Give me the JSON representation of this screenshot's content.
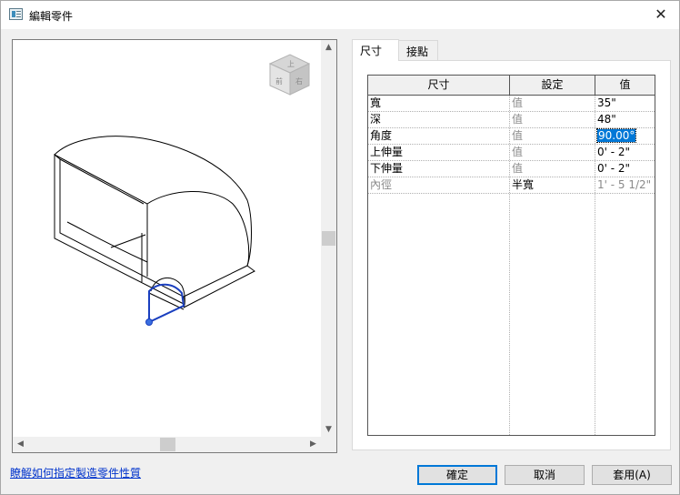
{
  "window": {
    "title": "編輯零件",
    "close_glyph": "✕"
  },
  "preview": {
    "scroll_up": "▲",
    "scroll_down": "▼",
    "scroll_left": "◀",
    "scroll_right": "▶",
    "viewcube_faces": [
      "上",
      "前",
      "右"
    ]
  },
  "tabs": [
    {
      "label": "尺寸",
      "active": true
    },
    {
      "label": "接點",
      "active": false
    }
  ],
  "grid": {
    "headers": [
      "尺寸",
      "設定",
      "值"
    ],
    "rows": [
      {
        "name": "寬",
        "setting": "值",
        "value": "35\"",
        "setting_gray": true,
        "value_gray": false
      },
      {
        "name": "深",
        "setting": "值",
        "value": "48\"",
        "setting_gray": true,
        "value_gray": false
      },
      {
        "name": "角度",
        "setting": "值",
        "value": "90.00°",
        "setting_gray": true,
        "value_gray": false,
        "selected": true
      },
      {
        "name": "上伸量",
        "setting": "值",
        "value": "0' - 2\"",
        "setting_gray": true,
        "value_gray": false
      },
      {
        "name": "下伸量",
        "setting": "值",
        "value": "0' - 2\"",
        "setting_gray": true,
        "value_gray": false
      },
      {
        "name": "內徑",
        "setting": "半寬",
        "value": "1' - 5 1/2\"",
        "setting_gray": false,
        "value_gray": true,
        "name_gray": true
      }
    ]
  },
  "footer": {
    "help_link": "瞭解如何指定製造零件性質",
    "ok": "確定",
    "cancel": "取消",
    "apply": "套用(A)"
  },
  "colors": {
    "selection": "#0078d7",
    "link": "#0033cc",
    "gizmo": "#1a3fbf"
  }
}
